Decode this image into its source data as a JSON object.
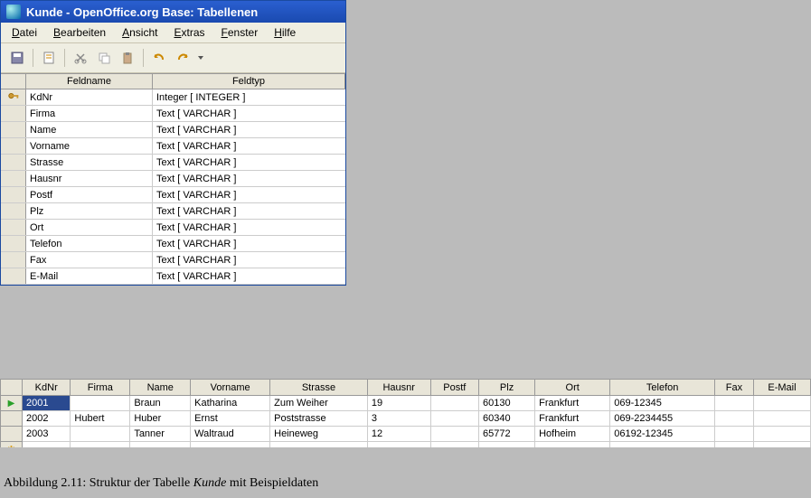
{
  "window": {
    "title": "Kunde - OpenOffice.org Base: Tabellenen"
  },
  "menubar": {
    "items": [
      {
        "label": "Datei",
        "ul": "D"
      },
      {
        "label": "Bearbeiten",
        "ul": "B"
      },
      {
        "label": "Ansicht",
        "ul": "A"
      },
      {
        "label": "Extras",
        "ul": "E"
      },
      {
        "label": "Fenster",
        "ul": "F"
      },
      {
        "label": "Hilfe",
        "ul": "H"
      }
    ]
  },
  "design": {
    "headers": {
      "field": "Feldname",
      "type": "Feldtyp"
    },
    "rows": [
      {
        "key": true,
        "name": "KdNr",
        "type": "Integer [ INTEGER ]"
      },
      {
        "key": false,
        "name": "Firma",
        "type": "Text [ VARCHAR ]"
      },
      {
        "key": false,
        "name": "Name",
        "type": "Text [ VARCHAR ]"
      },
      {
        "key": false,
        "name": "Vorname",
        "type": "Text [ VARCHAR ]"
      },
      {
        "key": false,
        "name": "Strasse",
        "type": "Text [ VARCHAR ]"
      },
      {
        "key": false,
        "name": "Hausnr",
        "type": "Text [ VARCHAR ]"
      },
      {
        "key": false,
        "name": "Postf",
        "type": "Text [ VARCHAR ]"
      },
      {
        "key": false,
        "name": "Plz",
        "type": "Text [ VARCHAR ]"
      },
      {
        "key": false,
        "name": "Ort",
        "type": "Text [ VARCHAR ]"
      },
      {
        "key": false,
        "name": "Telefon",
        "type": "Text [ VARCHAR ]"
      },
      {
        "key": false,
        "name": "Fax",
        "type": "Text [ VARCHAR ]"
      },
      {
        "key": false,
        "name": "E-Mail",
        "type": "Text [ VARCHAR ]"
      }
    ]
  },
  "datagrid": {
    "columns": [
      "KdNr",
      "Firma",
      "Name",
      "Vorname",
      "Strasse",
      "Hausnr",
      "Postf",
      "Plz",
      "Ort",
      "Telefon",
      "Fax",
      "E-Mail"
    ],
    "rows": [
      {
        "marker": "current",
        "cells": [
          "2001",
          "",
          "Braun",
          "Katharina",
          "Zum Weiher",
          "19",
          "",
          "60130",
          "Frankfurt",
          "069-12345",
          "",
          ""
        ]
      },
      {
        "marker": "",
        "cells": [
          "2002",
          "Hubert",
          "Huber",
          "Ernst",
          "Poststrasse",
          "3",
          "",
          "60340",
          "Frankfurt",
          "069-2234455",
          "",
          ""
        ]
      },
      {
        "marker": "",
        "cells": [
          "2003",
          "",
          "Tanner",
          "Waltraud",
          "Heineweg",
          "12",
          "",
          "65772",
          "Hofheim",
          "06192-12345",
          "",
          ""
        ]
      },
      {
        "marker": "new",
        "cells": [
          "",
          "",
          "",
          "",
          "",
          "",
          "",
          "",
          "",
          "",
          "",
          ""
        ]
      }
    ],
    "selected": {
      "row": 0,
      "col": 0
    }
  },
  "caption": {
    "pre": "Abbildung 2.11: Struktur der Tabelle  ",
    "em": "Kunde",
    "post": " mit Beispieldaten"
  }
}
